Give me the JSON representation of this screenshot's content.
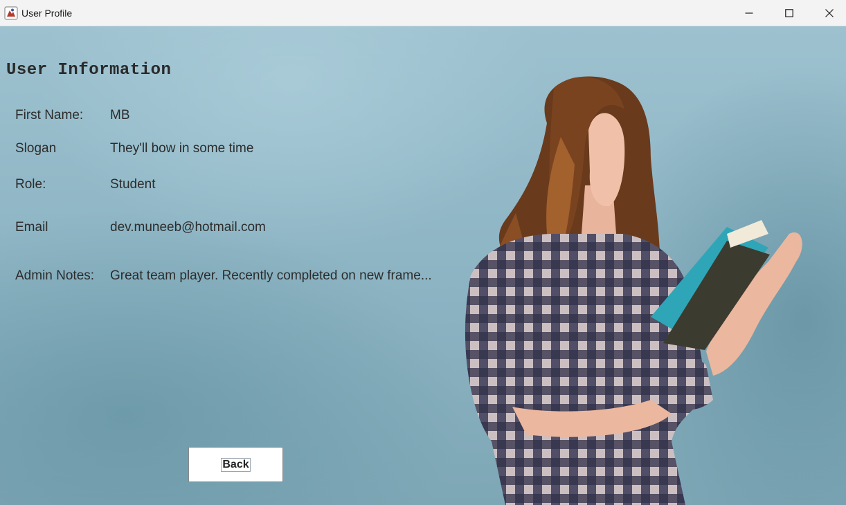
{
  "window": {
    "title": "User Profile",
    "icon": "java-app-icon",
    "controls": [
      "minimize-icon",
      "maximize-icon",
      "close-icon"
    ]
  },
  "profile": {
    "heading": "User Information",
    "fields": [
      {
        "label": "First Name:",
        "value": "MB"
      },
      {
        "label": "Slogan",
        "value": "They'll bow in some time"
      },
      {
        "label": "Role:",
        "value": "Student"
      },
      {
        "label": "Email",
        "value": "dev.muneeb@hotmail.com"
      },
      {
        "label": "Admin Notes:",
        "value": "Great team player. Recently completed on new frame..."
      }
    ]
  },
  "actions": {
    "back_label": "Back"
  },
  "background": {
    "subject": "woman-reading-book-photo",
    "base_color": "#8fb6c5"
  }
}
